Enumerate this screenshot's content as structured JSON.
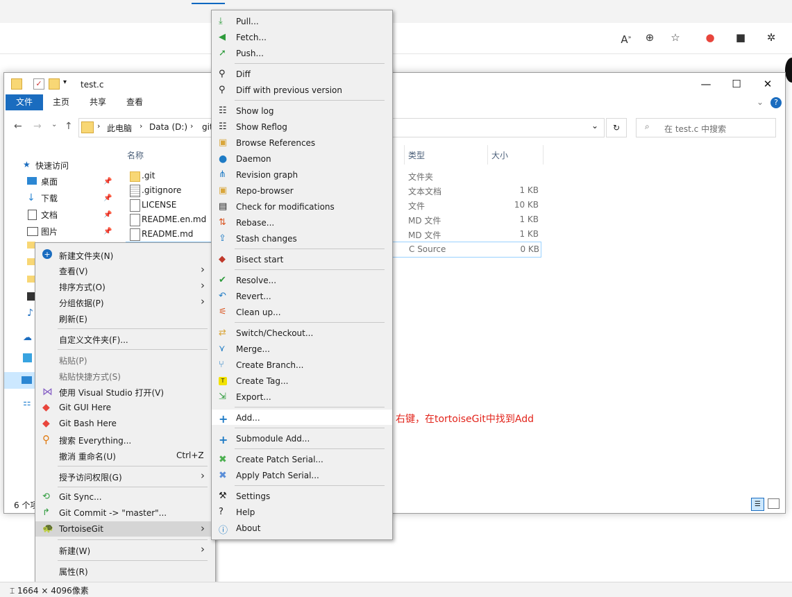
{
  "explorer": {
    "title": "test.c",
    "ribbon_tabs": [
      "文件",
      "主页",
      "共享",
      "查看"
    ],
    "breadcrumb": [
      "此电脑",
      "Data (D:)",
      "git"
    ],
    "search_placeholder": "在 test.c 中搜索",
    "columns": [
      "名称",
      "类型",
      "大小"
    ],
    "files": [
      {
        "name": ".git",
        "type": "文件夹",
        "size": ""
      },
      {
        "name": ".gitignore",
        "type": "文本文档",
        "size": "1 KB"
      },
      {
        "name": "LICENSE",
        "type": "文件",
        "size": "10 KB"
      },
      {
        "name": "README.en.md",
        "type": "MD 文件",
        "size": "1 KB"
      },
      {
        "name": "README.md",
        "type": "MD 文件",
        "size": "1 KB"
      },
      {
        "name": "",
        "type": "C Source",
        "size": "0 KB"
      }
    ],
    "nav": {
      "quick_access": "快速访问",
      "items": [
        "桌面",
        "下载",
        "文档",
        "图片"
      ]
    },
    "status": "6 个项"
  },
  "context_menu": {
    "items": [
      {
        "label": "新建文件夹(N)"
      },
      {
        "label": "查看(V)"
      },
      {
        "label": "排序方式(O)"
      },
      {
        "label": "分组依据(P)"
      },
      {
        "label": "刷新(E)"
      },
      {
        "label": "自定义文件夹(F)..."
      },
      {
        "label": "粘贴(P)"
      },
      {
        "label": "粘贴快捷方式(S)"
      },
      {
        "label": "使用 Visual Studio 打开(V)"
      },
      {
        "label": "Git GUI Here"
      },
      {
        "label": "Git Bash Here"
      },
      {
        "label": "搜索 Everything..."
      },
      {
        "label": "撤消 重命名(U)",
        "shortcut": "Ctrl+Z"
      },
      {
        "label": "授予访问权限(G)"
      },
      {
        "label": "Git Sync..."
      },
      {
        "label": "Git Commit -> \"master\"..."
      },
      {
        "label": "TortoiseGit"
      },
      {
        "label": "新建(W)"
      },
      {
        "label": "属性(R)"
      }
    ]
  },
  "tortoise_menu": {
    "items": [
      {
        "label": "Pull..."
      },
      {
        "label": "Fetch..."
      },
      {
        "label": "Push..."
      },
      {
        "label": "Diff"
      },
      {
        "label": "Diff with previous version"
      },
      {
        "label": "Show log"
      },
      {
        "label": "Show Reflog"
      },
      {
        "label": "Browse References"
      },
      {
        "label": "Daemon"
      },
      {
        "label": "Revision graph"
      },
      {
        "label": "Repo-browser"
      },
      {
        "label": "Check for modifications"
      },
      {
        "label": "Rebase..."
      },
      {
        "label": "Stash changes"
      },
      {
        "label": "Bisect start"
      },
      {
        "label": "Resolve..."
      },
      {
        "label": "Revert..."
      },
      {
        "label": "Clean up..."
      },
      {
        "label": "Switch/Checkout..."
      },
      {
        "label": "Merge..."
      },
      {
        "label": "Create Branch..."
      },
      {
        "label": "Create Tag..."
      },
      {
        "label": "Export..."
      },
      {
        "label": "Add..."
      },
      {
        "label": "Submodule Add..."
      },
      {
        "label": "Create Patch Serial..."
      },
      {
        "label": "Apply Patch Serial..."
      },
      {
        "label": "Settings"
      },
      {
        "label": "Help"
      },
      {
        "label": "About"
      }
    ]
  },
  "annotation": "右键，在tortoiseGit中找到Add",
  "image_size": "1664 × 4096像素",
  "colors": {
    "accent": "#1a6cbf",
    "annotation": "#e2241b",
    "menu_bg": "#f0f0f0"
  }
}
